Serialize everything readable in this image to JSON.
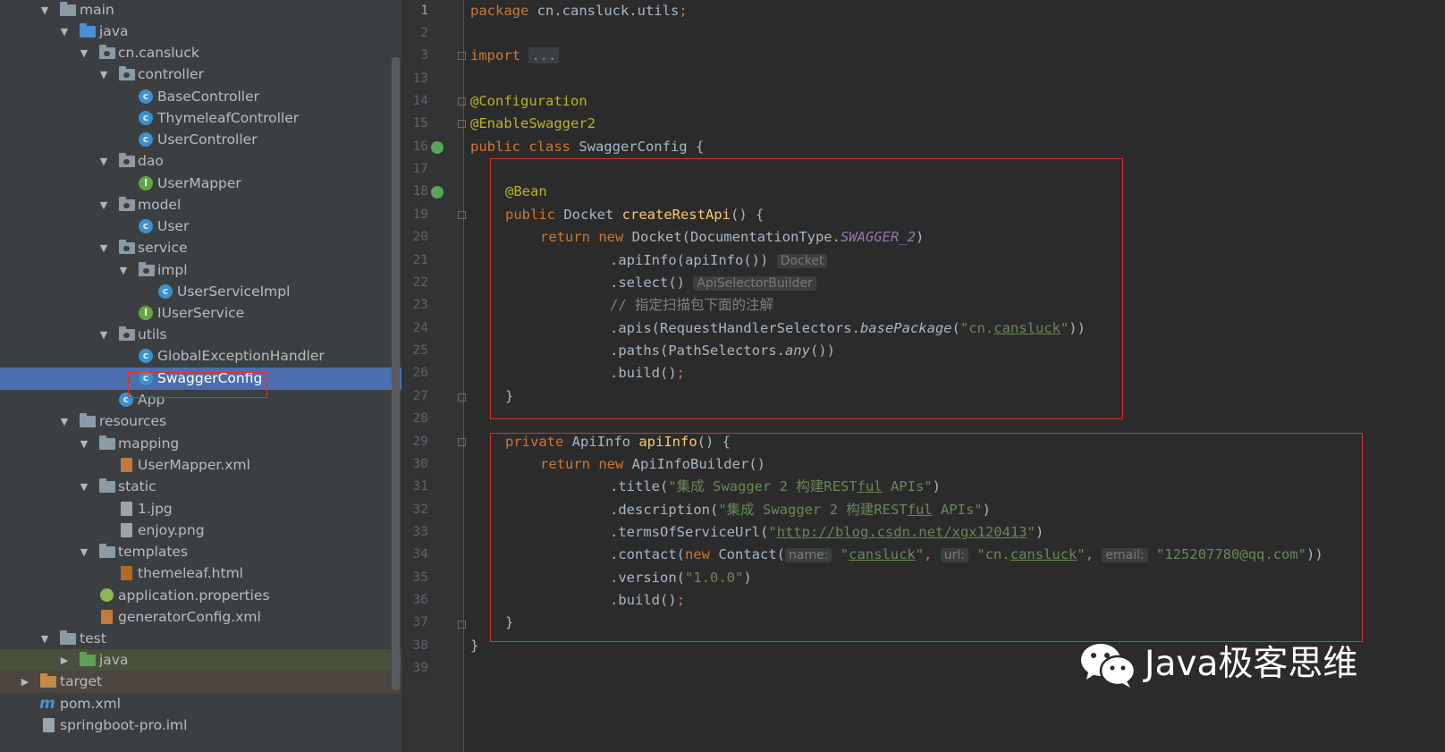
{
  "tree": {
    "items": [
      {
        "label": "main",
        "depth": 0
      },
      {
        "label": "java",
        "depth": 1
      },
      {
        "label": "cn.cansluck",
        "depth": 2
      },
      {
        "label": "controller",
        "depth": 3
      },
      {
        "label": "BaseController",
        "depth": 4
      },
      {
        "label": "ThymeleafController",
        "depth": 4
      },
      {
        "label": "UserController",
        "depth": 4
      },
      {
        "label": "dao",
        "depth": 3
      },
      {
        "label": "UserMapper",
        "depth": 4
      },
      {
        "label": "model",
        "depth": 3
      },
      {
        "label": "User",
        "depth": 4
      },
      {
        "label": "service",
        "depth": 3
      },
      {
        "label": "impl",
        "depth": 4
      },
      {
        "label": "UserServiceImpl",
        "depth": 5
      },
      {
        "label": "IUserService",
        "depth": 4
      },
      {
        "label": "utils",
        "depth": 3
      },
      {
        "label": "GlobalExceptionHandler",
        "depth": 4
      },
      {
        "label": "SwaggerConfig",
        "depth": 4
      },
      {
        "label": "App",
        "depth": 3
      },
      {
        "label": "resources",
        "depth": 1
      },
      {
        "label": "mapping",
        "depth": 2
      },
      {
        "label": "UserMapper.xml",
        "depth": 3
      },
      {
        "label": "static",
        "depth": 2
      },
      {
        "label": "1.jpg",
        "depth": 3
      },
      {
        "label": "enjoy.png",
        "depth": 3
      },
      {
        "label": "templates",
        "depth": 2
      },
      {
        "label": "themeleaf.html",
        "depth": 3
      },
      {
        "label": "application.properties",
        "depth": 2
      },
      {
        "label": "generatorConfig.xml",
        "depth": 2
      },
      {
        "label": "test",
        "depth": 0
      },
      {
        "label": "java",
        "depth": 1
      },
      {
        "label": "target",
        "depth": -1
      },
      {
        "label": "pom.xml",
        "depth": -1
      },
      {
        "label": "springboot-pro.iml",
        "depth": -1
      }
    ],
    "selected": "SwaggerConfig"
  },
  "editor": {
    "line_numbers": [
      "1",
      "2",
      "3",
      "13",
      "14",
      "15",
      "16",
      "17",
      "18",
      "19",
      "20",
      "21",
      "22",
      "23",
      "24",
      "25",
      "26",
      "27",
      "28",
      "29",
      "30",
      "31",
      "32",
      "33",
      "34",
      "35",
      "36",
      "37",
      "38",
      "39"
    ],
    "code": {
      "l1_kw": "package",
      "l1_rest": " cn.cansluck.utils",
      "l1_semi": ";",
      "l3_kw": "import",
      "l3_fold": "...",
      "l14": "@Configuration",
      "l15": "@EnableSwagger2",
      "l16_kw": "public class",
      "l16_rest": " SwaggerConfig {",
      "l18": "@Bean",
      "l19_kw": "public",
      "l19_type": " Docket ",
      "l19_fn": "createRestApi",
      "l19_rest": "() {",
      "l20_kw": "return new",
      "l20_rest": " Docket(DocumentationType.",
      "l20_static": "SWAGGER_2",
      "l20_end": ")",
      "l21": ".apiInfo(apiInfo())",
      "l21_hint": "Docket",
      "l22": ".select()",
      "l22_hint": "ApiSelectorBuilder",
      "l23": "// 指定扫描包下面的注解",
      "l24_a": ".apis(RequestHandlerSelectors.",
      "l24_m": "basePackage",
      "l24_b": "(",
      "l24_s1": "\"cn.",
      "l24_s2": "cansluck",
      "l24_s3": "\"",
      "l24_c": "))",
      "l25_a": ".paths(PathSelectors.",
      "l25_m": "any",
      "l25_b": "())",
      "l26": ".build()",
      "l26_semi": ";",
      "l27": "}",
      "l29_kw": "private",
      "l29_type": " ApiInfo ",
      "l29_fn": "apiInfo",
      "l29_rest": "() {",
      "l30_kw": "return new",
      "l30_rest": " ApiInfoBuilder()",
      "l31_a": ".title(",
      "l31_s1": "\"集成 Swagger 2 构建REST",
      "l31_s2": "ful",
      "l31_s3": " APIs\"",
      "l31_b": ")",
      "l32_a": ".description(",
      "l32_s1": "\"集成 Swagger 2 构建REST",
      "l32_s2": "ful",
      "l32_s3": " APIs\"",
      "l32_b": ")",
      "l33_a": ".termsOfServiceUrl(",
      "l33_q1": "\"",
      "l33_url": "http://blog.csdn.net/xgx120413",
      "l33_q2": "\"",
      "l33_b": ")",
      "l34_a": ".contact(",
      "l34_kw": "new",
      "l34_b": " Contact(",
      "l34_h1": "name:",
      "l34_s1a": "\"",
      "l34_s1b": "cansluck",
      "l34_s1c": "\"",
      "l34_c1": ", ",
      "l34_h2": "url:",
      "l34_s2a": "\"cn.",
      "l34_s2b": "cansluck",
      "l34_s2c": "\"",
      "l34_c2": ", ",
      "l34_h3": "email:",
      "l34_s3": "\"125207780@qq.com\"",
      "l34_end": "))",
      "l35_a": ".version(",
      "l35_s": "\"1.0.0\"",
      "l35_b": ")",
      "l36": ".build()",
      "l36_semi": ";",
      "l37": "}",
      "l38": "}"
    }
  },
  "watermark": {
    "text": "Java极客思维",
    "icon": "wechat-icon"
  },
  "colors": {
    "keyword": "#cc7832",
    "annotation": "#bbb529",
    "function": "#ffc66d",
    "string": "#6a8759",
    "selection": "#4b6eaf",
    "highlight_box": "#e03030"
  }
}
